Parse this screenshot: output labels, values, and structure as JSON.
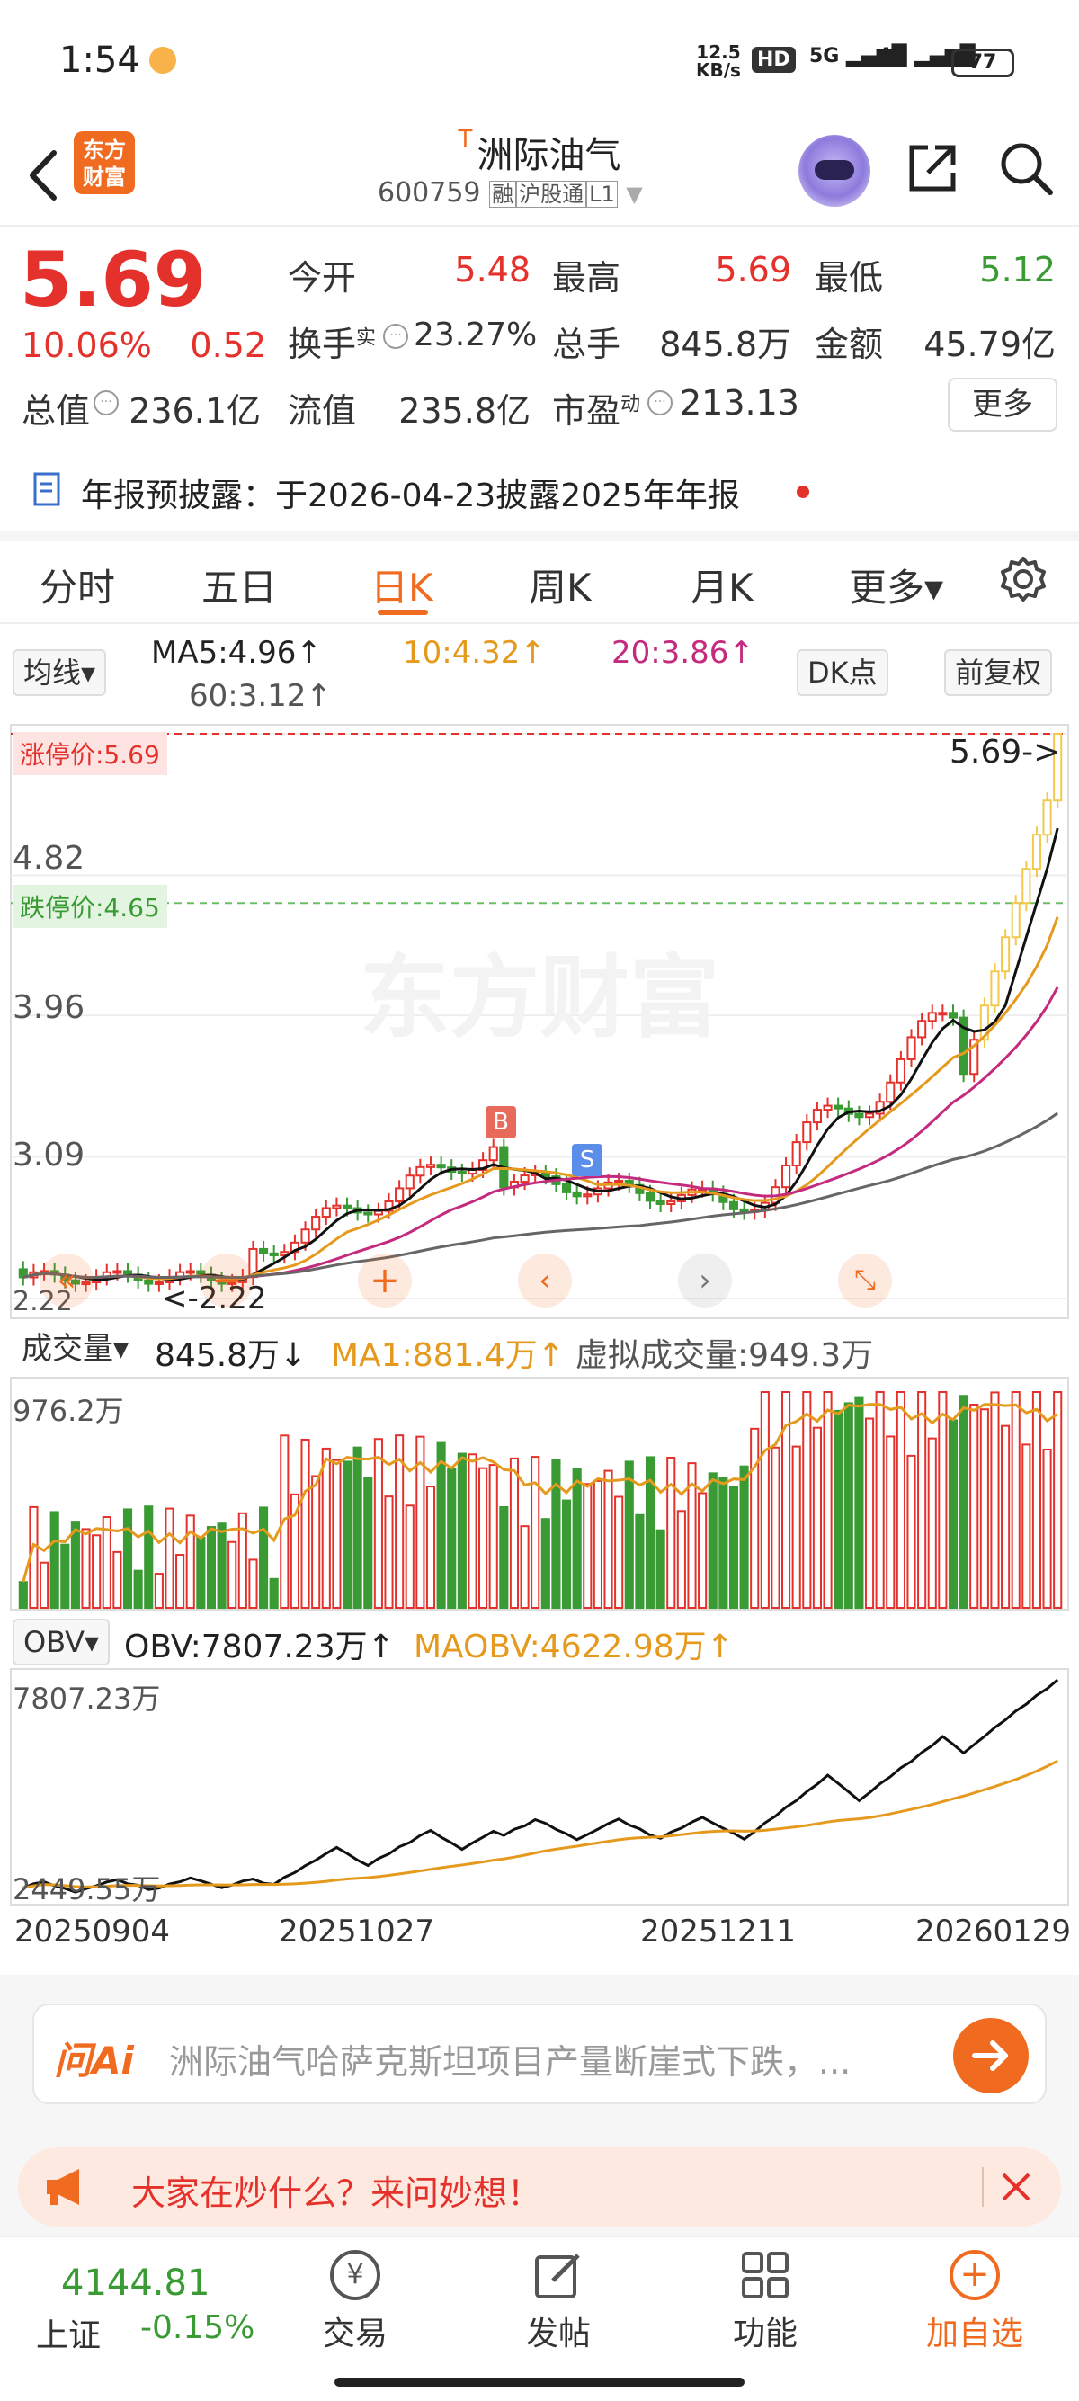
{
  "status": {
    "time": "1:54",
    "speed_top": "12.5",
    "speed_bottom": "KB/s",
    "hd": "HD",
    "net1": "5G",
    "net2": "4G",
    "battery": "77"
  },
  "header": {
    "app_logo_line1": "东方",
    "app_logo_line2": "财富",
    "stock_prefix": "T",
    "stock_name": "洲际油气",
    "stock_code": "600759",
    "tag_rong": "融",
    "tag_hgt": "沪股通",
    "tag_l1": "L1"
  },
  "quote": {
    "price": "5.69",
    "change_pct": "10.06%",
    "change_amt": "0.52",
    "open_label": "今开",
    "open": "5.48",
    "high_label": "最高",
    "high": "5.69",
    "low_label": "最低",
    "low": "5.12",
    "turnover_label": "换手",
    "turnover_sup": "实",
    "turnover": "23.27%",
    "volume_label": "总手",
    "volume": "845.8万",
    "amount_label": "金额",
    "amount": "45.79亿",
    "mcap_label": "总值",
    "mcap": "236.1亿",
    "float_label": "流值",
    "float": "235.8亿",
    "pe_label": "市盈",
    "pe_sup": "动",
    "pe": "213.13",
    "more_button": "更多"
  },
  "notice": {
    "text": "年报预披露：于2026-04-23披露2025年年报"
  },
  "tabs": [
    {
      "label": "分时"
    },
    {
      "label": "五日"
    },
    {
      "label": "日K"
    },
    {
      "label": "周K"
    },
    {
      "label": "月K"
    },
    {
      "label": "更多▾"
    }
  ],
  "ma_bar": {
    "select": "均线▾",
    "ma5": "MA5:4.96↑",
    "ma10": "10:4.32↑",
    "ma20": "20:3.86↑",
    "ma60": "60:3.12↑",
    "dk": "DK点",
    "fq": "前复权"
  },
  "main_chart": {
    "limit_up_label": "涨停价:5.69",
    "limit_down_label": "跌停价:4.65",
    "y_ticks": [
      "5.69",
      "4.82",
      "3.96",
      "3.09",
      "2.22"
    ],
    "last_price_label": "5.69->",
    "min_label": "<-2.22",
    "buy_marker": "B",
    "sell_marker": "S",
    "watermark": "东方财富"
  },
  "volume_panel": {
    "select": "成交量▾",
    "vol": "845.8万↓",
    "ma1": "MA1:881.4万↑",
    "virtual": "虚拟成交量:949.3万",
    "y_top": "976.2万"
  },
  "obv_panel": {
    "select": "OBV▾",
    "obv": "OBV:7807.23万↑",
    "maobv": "MAOBV:4622.98万↑",
    "y_top": "7807.23万",
    "y_bottom": "2449.55万"
  },
  "dates": [
    "20250904",
    "20251027",
    "20251211",
    "20260129"
  ],
  "ask_ai": {
    "logo": "问Ai",
    "placeholder": "洲际油气哈萨克斯坦项目产量断崖式下跌，..."
  },
  "banner": {
    "text": "大家在炒什么？来问妙想！"
  },
  "bottom_nav": {
    "index_value": "4144.81",
    "index_name": "上证",
    "index_change": "-0.15%",
    "items": [
      {
        "label": "交易"
      },
      {
        "label": "发帖"
      },
      {
        "label": "功能"
      },
      {
        "label": "加自选"
      }
    ]
  },
  "colors": {
    "up": "#e5312b",
    "down": "#3a9b35",
    "ma10": "#e59a1e",
    "ma20": "#c42a7e",
    "accent": "#f06a1f"
  }
}
